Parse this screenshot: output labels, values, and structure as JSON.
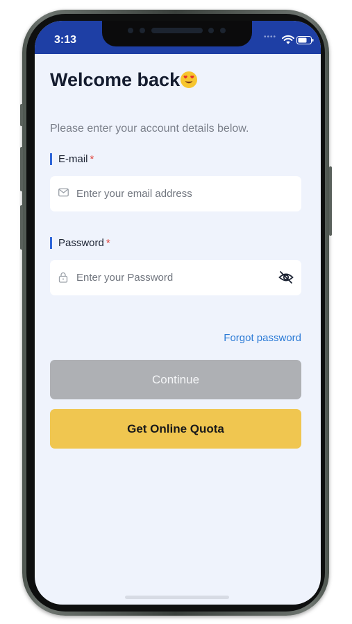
{
  "status_bar": {
    "time": "3:13",
    "background_color": "#1e3fa5",
    "icons": [
      "signal-dots-icon",
      "wifi-icon",
      "battery-icon"
    ]
  },
  "header": {
    "title": "Welcome back",
    "title_emoji": "heart-eyes-emoji-icon",
    "subtitle": "Please enter your account details below."
  },
  "form": {
    "email": {
      "label": "E-mail",
      "required_mark": "*",
      "placeholder": "Enter your email address",
      "value": "",
      "icon": "mail-icon"
    },
    "password": {
      "label": "Password",
      "required_mark": "*",
      "placeholder": "Enter your Password",
      "value": "",
      "icon": "lock-icon",
      "toggle_icon": "eye-off-icon"
    },
    "forgot_password": "Forgot password"
  },
  "actions": {
    "continue_label": "Continue",
    "continue_color": "#aeb0b4",
    "quota_label": "Get Online Quota",
    "quota_color": "#f0c650"
  },
  "colors": {
    "accent": "#2f66d8",
    "link": "#2a7ad6",
    "required": "#e0423a",
    "screen_background": "#eff3fc"
  }
}
